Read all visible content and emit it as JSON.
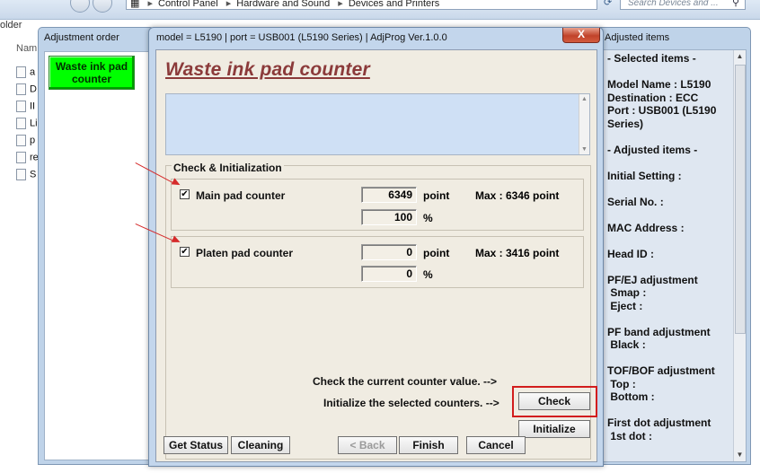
{
  "explorer": {
    "breadcrumb": [
      "Control Panel",
      "Hardware and Sound",
      "Devices and Printers"
    ],
    "search_placeholder": "Search Devices and ...",
    "left_label": "older",
    "name_header": "Nam",
    "files": [
      {
        "label": "a"
      },
      {
        "label": "D"
      },
      {
        "label": "II"
      },
      {
        "label": "Li"
      },
      {
        "label": "p"
      },
      {
        "label": "re"
      },
      {
        "label": "S"
      }
    ]
  },
  "adjustment_order": {
    "title": "Adjustment order",
    "selected_item": "Waste ink pad counter"
  },
  "dialog": {
    "title": "model = L5190 | port = USB001 (L5190 Series) | AdjProg Ver.1.0.0",
    "close_label": "X",
    "heading": "Waste ink pad counter",
    "group_title": "Check & Initialization",
    "counters": [
      {
        "label": "Main pad counter",
        "checked": true,
        "check_mark": "✔",
        "point_value": "6349",
        "point_unit": "point",
        "max_text": "Max : 6346 point",
        "percent_value": "100",
        "percent_unit": "%"
      },
      {
        "label": "Platen pad counter",
        "checked": true,
        "check_mark": "✔",
        "point_value": "0",
        "point_unit": "point",
        "max_text": "Max : 3416 point",
        "percent_value": "0",
        "percent_unit": "%"
      }
    ],
    "check_prompt": "Check the current counter value. -->",
    "check_button": "Check",
    "init_prompt": "Initialize the selected counters. -->",
    "init_button": "Initialize",
    "footer": {
      "get_status": "Get Status",
      "cleaning": "Cleaning",
      "back": "< Back",
      "finish": "Finish",
      "cancel": "Cancel"
    }
  },
  "adjusted_items": {
    "title": "Adjusted items",
    "lines": [
      "- Selected items -",
      "",
      "Model Name : L5190",
      "Destination : ECC",
      "Port : USB001 (L5190",
      "Series)",
      "",
      "- Adjusted items -",
      "",
      "Initial Setting :",
      "",
      "Serial No. :",
      "",
      "MAC Address :",
      "",
      "Head ID :",
      "",
      "PF/EJ adjustment",
      " Smap :",
      " Eject :",
      "",
      "PF band adjustment",
      " Black :",
      "",
      "TOF/BOF adjustment",
      " Top :",
      " Bottom :",
      "",
      "First dot adjustment",
      " 1st dot :"
    ]
  },
  "colors": {
    "highlight_red": "#d21d1d",
    "selected_green": "#00ff00",
    "heading_color": "#8b3a3a"
  }
}
